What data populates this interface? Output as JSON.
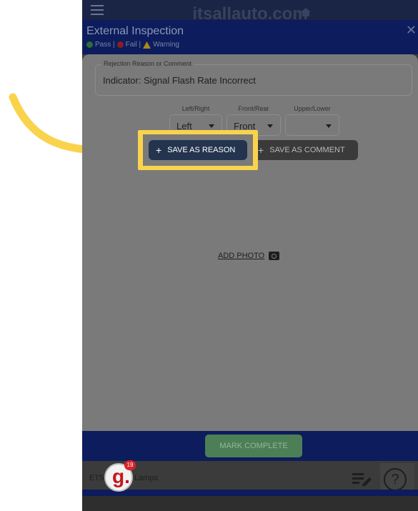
{
  "topbar": {
    "brand": "itsallauto.com"
  },
  "header": {
    "title": "External Inspection",
    "legend": {
      "pass": "Pass |",
      "fail": "Fail |",
      "warning": "Warning"
    }
  },
  "form": {
    "comment_label": "Rejection Reason or Comment",
    "comment_value": "Indicator: Signal Flash Rate Incorrect",
    "selects": [
      {
        "label": "Left/Right",
        "value": "Left"
      },
      {
        "label": "Front/Rear",
        "value": "Front"
      },
      {
        "label": "Upper/Lower",
        "value": ""
      }
    ],
    "save_reason": "SAVE AS REASON",
    "save_comment": "SAVE AS COMMENT",
    "add_photo": "ADD PHOTO"
  },
  "footer": {
    "mark_complete": "MARK COMPLETE"
  },
  "bottom": {
    "item_text": "ET5",
    "item_suffix": "Lamps",
    "help": "?"
  },
  "badge": {
    "letter": "g.",
    "count": "19"
  },
  "colors": {
    "highlight": "#fad34d",
    "nav": "#0d1c5c",
    "complete": "#4c7f55",
    "badge": "#d8232a"
  }
}
